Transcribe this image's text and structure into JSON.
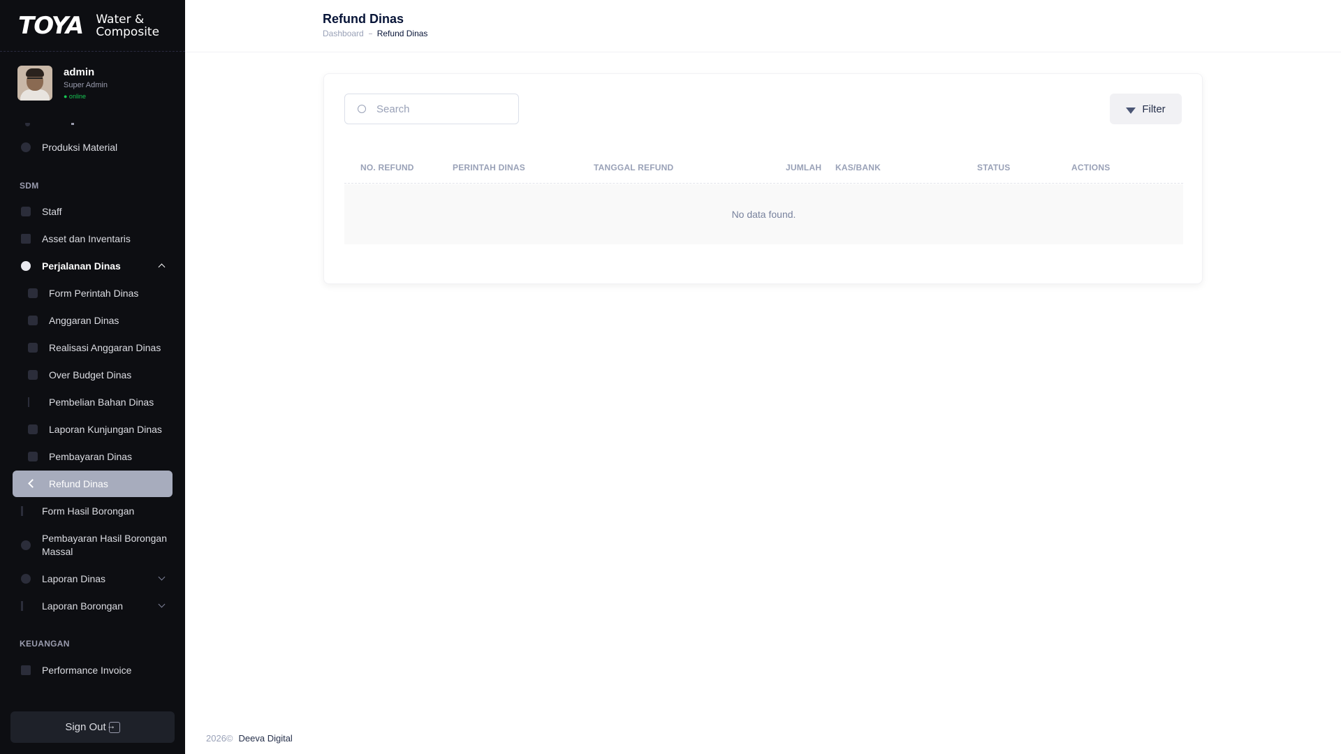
{
  "brand": {
    "logo": "TOYA",
    "line1": "Water &",
    "line2": "Composite"
  },
  "user": {
    "name": "admin",
    "role": "Super Admin",
    "status": "● online"
  },
  "sidebar": {
    "items": [
      {
        "label": "Produksi Material"
      },
      {
        "section": "SDM"
      },
      {
        "label": "Staff"
      },
      {
        "label": "Asset dan Inventaris"
      },
      {
        "label": "Perjalanan Dinas"
      },
      {
        "label": "Form Perintah Dinas"
      },
      {
        "label": "Anggaran Dinas"
      },
      {
        "label": "Realisasi Anggaran Dinas"
      },
      {
        "label": "Over Budget Dinas"
      },
      {
        "label": "Pembelian Bahan Dinas"
      },
      {
        "label": "Laporan Kunjungan Dinas"
      },
      {
        "label": "Pembayaran Dinas"
      },
      {
        "label": "Refund Dinas"
      },
      {
        "label": "Form Hasil Borongan"
      },
      {
        "label_line1": "Pembayaran Hasil Borongan",
        "label_line2": "Massal"
      },
      {
        "label": "Laporan Dinas"
      },
      {
        "label": "Laporan Borongan"
      },
      {
        "section": "KEUANGAN"
      },
      {
        "label": "Performance Invoice"
      }
    ],
    "signout": "Sign Out"
  },
  "header": {
    "title": "Refund Dinas",
    "breadcrumb": {
      "home": "Dashboard",
      "current": "Refund Dinas"
    }
  },
  "toolbar": {
    "search_placeholder": "Search",
    "filter_label": "Filter"
  },
  "table": {
    "columns": [
      "NO. REFUND",
      "PERINTAH DINAS",
      "TANGGAL REFUND",
      "JUMLAH",
      "KAS/BANK",
      "STATUS",
      "ACTIONS"
    ],
    "empty": "No data found."
  },
  "footer": {
    "year": "2026©",
    "link": "Deeva Digital"
  },
  "colors": {
    "sidebar_bg": "#0d0e12",
    "active_item": "#a7acbd",
    "online": "#17c653"
  }
}
